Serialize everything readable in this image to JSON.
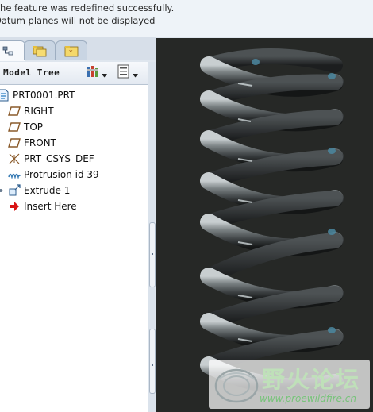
{
  "messages": [
    "The feature was redefined successfully.",
    "Datum planes will not be displayed"
  ],
  "tabs": [
    {
      "name": "model-tree-tab",
      "icon": "model-tree-icon"
    },
    {
      "name": "folder-browser-tab",
      "icon": "folder-icon"
    },
    {
      "name": "favorites-tab",
      "icon": "favorites-folder-icon"
    }
  ],
  "model_tree": {
    "title": "Model Tree",
    "settings_icon": "tree-settings-icon",
    "show_icon": "tree-show-icon",
    "items": [
      {
        "label": "PRT0001.PRT",
        "icon": "part-icon"
      },
      {
        "label": "RIGHT",
        "icon": "datum-plane-icon"
      },
      {
        "label": "TOP",
        "icon": "datum-plane-icon"
      },
      {
        "label": "FRONT",
        "icon": "datum-plane-icon"
      },
      {
        "label": "PRT_CSYS_DEF",
        "icon": "coordinate-system-icon"
      },
      {
        "label": "Protrusion id 39",
        "icon": "helical-sweep-icon"
      },
      {
        "label": "Extrude 1",
        "icon": "extrude-icon"
      },
      {
        "label": "Insert Here",
        "icon": "insert-here-arrow-icon"
      }
    ]
  },
  "colors": {
    "viewport_bg": "#262826",
    "spring": "#6d7374",
    "accent": "#4b87a0",
    "insert_arrow": "#d81414"
  }
}
